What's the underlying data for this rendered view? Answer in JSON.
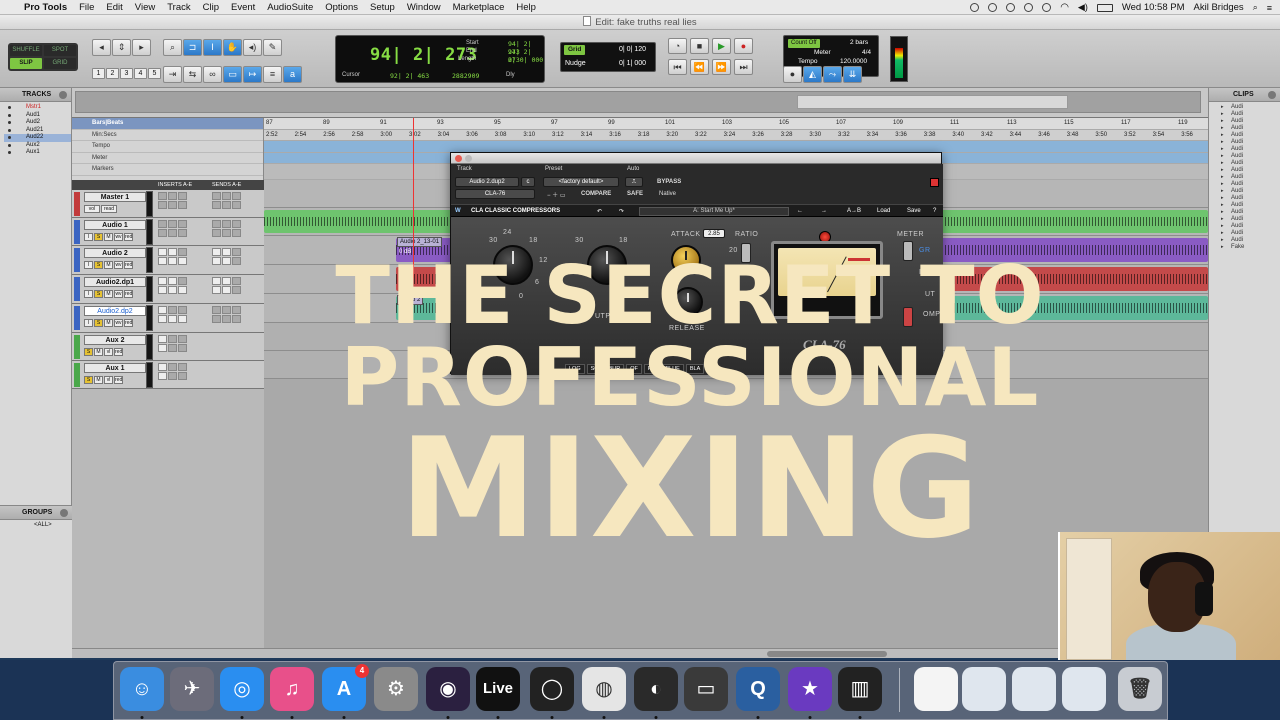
{
  "menubar": {
    "app": "Pro Tools",
    "items": [
      "File",
      "Edit",
      "View",
      "Track",
      "Clip",
      "Event",
      "AudioSuite",
      "Options",
      "Setup",
      "Window",
      "Marketplace",
      "Help"
    ],
    "clock": "Wed 10:58 PM",
    "user": "Akil Bridges"
  },
  "window": {
    "title": "Edit: fake truths real lies"
  },
  "toolbar": {
    "modes": [
      "SHUFFLE",
      "SPOT",
      "SLIP",
      "GRID"
    ],
    "active_mode": "SLIP",
    "zoom_presets": [
      "1",
      "2",
      "3",
      "4",
      "5"
    ],
    "counter": {
      "main": "94| 2| 273",
      "start_label": "Start",
      "start": "94| 2| 273",
      "end_label": "End",
      "end": "94| 2| 273",
      "length_label": "Length",
      "length": "0| 0| 000",
      "cursor_label": "Cursor",
      "cursor": "92| 2| 463",
      "samples": "2882909",
      "dly": "Dly"
    },
    "grid": {
      "label": "Grid",
      "value": "0| 0| 120"
    },
    "nudge": {
      "label": "Nudge",
      "value": "0| 1| 000"
    },
    "count_off": "Count Off",
    "count_bars": "2 bars",
    "meter_label": "Meter",
    "meter_value": "4/4",
    "tempo_label": "Tempo",
    "tempo_value": "120.0000"
  },
  "tracks_panel": {
    "title": "TRACKS",
    "items": [
      "Mstr1",
      "Aud1",
      "Aud2",
      "Aud21",
      "Aud22",
      "Aux2",
      "Aux1"
    ],
    "selected": 4
  },
  "groups_panel": {
    "title": "GROUPS",
    "items": [
      "<ALL>"
    ]
  },
  "clips_panel": {
    "title": "CLIPS",
    "items": [
      "Audi",
      "Audi",
      "Audi",
      "Audi",
      "Audi",
      "Audi",
      "Audi",
      "Audi",
      "Audi",
      "Audi",
      "Audi",
      "Audi",
      "Audi",
      "Audi",
      "Audi",
      "Audi",
      "Audi",
      "Audi",
      "Audi",
      "Audi",
      "Fake"
    ]
  },
  "rulers": {
    "labels": [
      "Bars|Beats",
      "Min:Secs",
      "Tempo",
      "Meter",
      "Markers"
    ],
    "bars": [
      "87",
      "89",
      "91",
      "93",
      "95",
      "97",
      "99",
      "101",
      "103",
      "105",
      "107",
      "109",
      "111",
      "113",
      "115",
      "117",
      "119"
    ],
    "minsecs": [
      "2:52",
      "2:54",
      "2:56",
      "2:58",
      "3:00",
      "3:02",
      "3:04",
      "3:06",
      "3:08",
      "3:10",
      "3:12",
      "3:14",
      "3:16",
      "3:18",
      "3:20",
      "3:22",
      "3:24",
      "3:26",
      "3:28",
      "3:30",
      "3:32",
      "3:34",
      "3:36",
      "3:38",
      "3:40",
      "3:42",
      "3:44",
      "3:46",
      "3:48",
      "3:50",
      "3:52",
      "3:54",
      "3:56"
    ]
  },
  "columns": {
    "inserts": "INSERTS A-E",
    "sends": "SENDS A-E"
  },
  "track_rows": [
    {
      "name": "Master 1",
      "color": "#c23a3a",
      "btns": [
        "vol",
        "read"
      ]
    },
    {
      "name": "Audio 1",
      "color": "#3a64c2",
      "btns": [
        "I",
        "S",
        "M",
        "wv",
        "red"
      ]
    },
    {
      "name": "Audio 2",
      "color": "#3a64c2",
      "btns": [
        "I",
        "S",
        "M",
        "wv",
        "red"
      ]
    },
    {
      "name": "Audio2.dp1",
      "color": "#3a64c2",
      "btns": [
        "I",
        "S",
        "M",
        "wv",
        "red"
      ]
    },
    {
      "name": "Audio2.dp2",
      "color": "#3a64c2",
      "btns": [
        "I",
        "S",
        "M",
        "wv",
        "red"
      ]
    },
    {
      "name": "Aux 2",
      "color": "#4aa84a",
      "btns": [
        "S",
        "M",
        "vl",
        "red"
      ]
    },
    {
      "name": "Aux 1",
      "color": "#4aa84a",
      "btns": [
        "S",
        "M",
        "vl",
        "red"
      ]
    }
  ],
  "clip_labels": [
    "Audio 2_13-01",
    "0 dB",
    "+0.1",
    "Audio 2",
    "+0.1"
  ],
  "plugin": {
    "track_label": "Track",
    "track_value": "Audio 2.dup2",
    "track_suffix": "c",
    "insert": "CLA-76",
    "preset_label": "Preset",
    "preset_value": "<factory default>",
    "compare": "COMPARE",
    "auto_label": "Auto",
    "bypass": "BYPASS",
    "safe": "SAFE",
    "native": "Native",
    "waves_title": "CLA CLASSIC COMPRESSORS",
    "preset_name": "A: Start Me Up*",
    "load": "Load",
    "save": "Save",
    "attack_label": "ATTACK",
    "attack_value": "2.85",
    "ratio_label": "RATIO",
    "ratio_marks": [
      "20",
      "12"
    ],
    "meter_label": "METER",
    "meter_opts": [
      "GR",
      "IN",
      "UT",
      "OMP"
    ],
    "release_label": "RELEASE",
    "output_label": "UTP",
    "knob_marks": [
      "24",
      "30",
      "18",
      "12",
      "36",
      "6",
      "0",
      "8"
    ],
    "brand": "CLA-76",
    "bottom_btns": [
      "LOG",
      "SO",
      "BUR",
      "OF",
      "RE",
      "BLUE",
      "BLA"
    ]
  },
  "overlay": {
    "line1": "THE SECRET TO",
    "line2": "PROFESSIONAL",
    "line3": "MIXING"
  },
  "dock": {
    "apps": [
      {
        "name": "finder-icon",
        "color": "#3a8de0",
        "glyph": "☺"
      },
      {
        "name": "launchpad-icon",
        "color": "#6c6c7a",
        "glyph": "✈"
      },
      {
        "name": "safari-icon",
        "color": "#2a8ef0",
        "glyph": "◎"
      },
      {
        "name": "itunes-icon",
        "color": "#e8508a",
        "glyph": "♫"
      },
      {
        "name": "app-store-icon",
        "color": "#2a8ef0",
        "glyph": "A"
      },
      {
        "name": "system-preferences-icon",
        "color": "#8a8a8a",
        "glyph": "⚙"
      },
      {
        "name": "pro-tools-icon",
        "color": "#2b2040",
        "glyph": "◉"
      },
      {
        "name": "ableton-live-icon",
        "color": "#1a1a1a",
        "glyph": "Live"
      },
      {
        "name": "obs-icon",
        "color": "#222",
        "glyph": "◯"
      },
      {
        "name": "chrome-icon",
        "color": "#e5e5e5",
        "glyph": "◍"
      },
      {
        "name": "disk-utility-icon",
        "color": "#2a2a2a",
        "glyph": "◐"
      },
      {
        "name": "printer-icon",
        "color": "#3a3a3a",
        "glyph": "▭"
      },
      {
        "name": "quicktime-icon",
        "color": "#2a5fa0",
        "glyph": "Q"
      },
      {
        "name": "imovie-icon",
        "color": "#6a3ac0",
        "glyph": "★"
      },
      {
        "name": "piano-icon",
        "color": "#222",
        "glyph": "▥"
      },
      {
        "name": "document-icon",
        "color": "#f4f4f4",
        "glyph": ""
      },
      {
        "name": "screenshot-icon",
        "color": "#dfe6ee",
        "glyph": ""
      },
      {
        "name": "screenshot-icon-2",
        "color": "#dfe6ee",
        "glyph": ""
      },
      {
        "name": "screenshot-icon-3",
        "color": "#dfe6ee",
        "glyph": ""
      },
      {
        "name": "trash-icon",
        "color": "#c8ccd2",
        "glyph": "🗑"
      }
    ],
    "app_store_badge": "4"
  },
  "colors": {
    "accent": "#7ec642",
    "selection": "#2b78c8",
    "overlay_text": "#f6e7bf"
  }
}
